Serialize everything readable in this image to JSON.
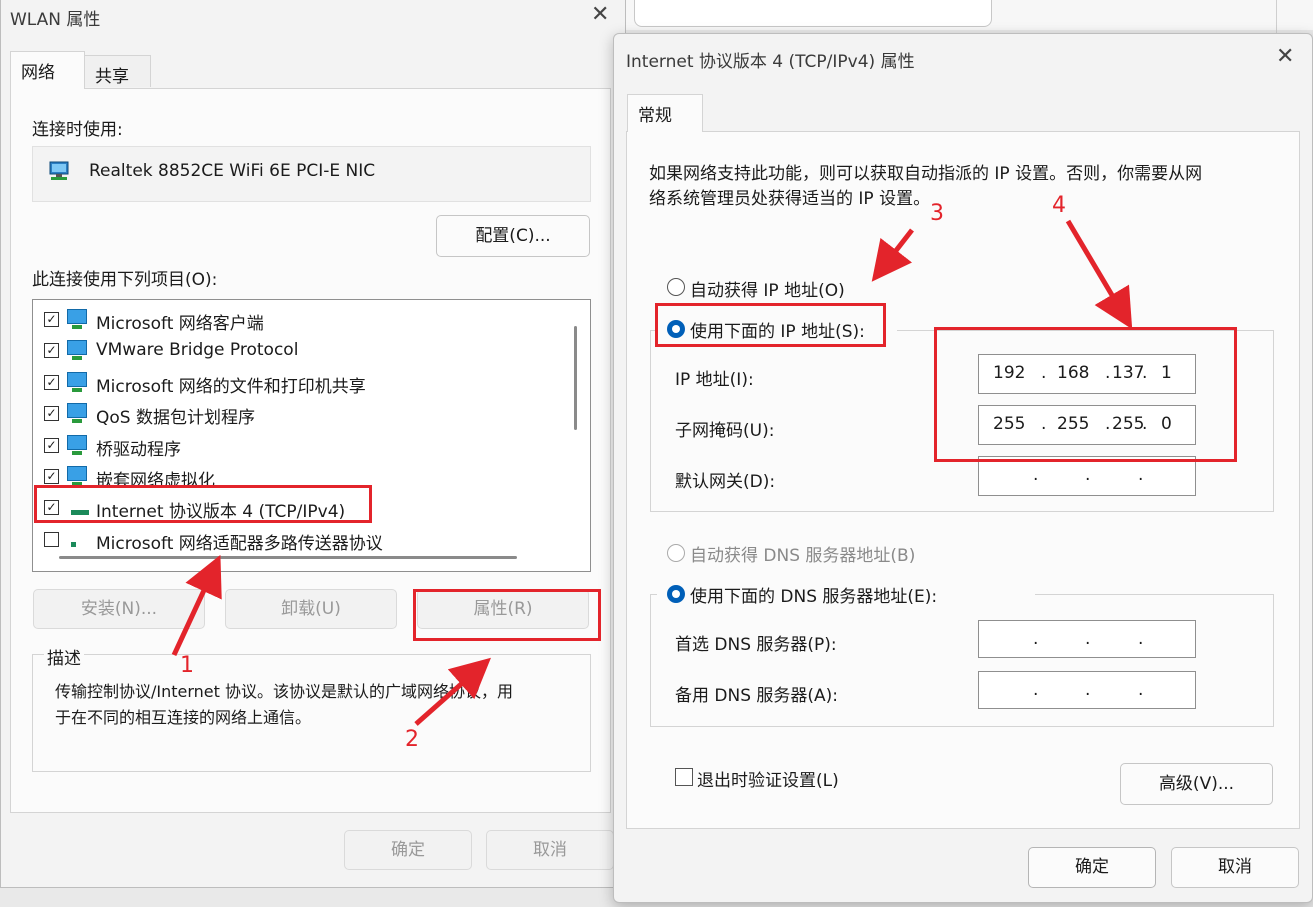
{
  "wlan": {
    "title": "WLAN 属性",
    "tabs": [
      "网络",
      "共享"
    ],
    "connect_using_label": "连接时使用:",
    "adapter_name": "Realtek 8852CE WiFi 6E PCI-E NIC",
    "configure_button": "配置(C)...",
    "items_label": "此连接使用下列项目(O):",
    "items": [
      {
        "label": "Microsoft 网络客户端",
        "checked": true
      },
      {
        "label": "VMware Bridge Protocol",
        "checked": true
      },
      {
        "label": "Microsoft 网络的文件和打印机共享",
        "checked": true
      },
      {
        "label": "QoS 数据包计划程序",
        "checked": true
      },
      {
        "label": "桥驱动程序",
        "checked": true
      },
      {
        "label": "嵌套网络虚拟化",
        "checked": true
      },
      {
        "label": "Internet 协议版本 4 (TCP/IPv4)",
        "checked": true
      },
      {
        "label": "Microsoft 网络适配器多路传送器协议",
        "checked": false
      }
    ],
    "install_button": "安装(N)...",
    "uninstall_button": "卸载(U)",
    "properties_button": "属性(R)",
    "description_title": "描述",
    "description_line1": "传输控制协议/Internet 协议。该协议是默认的广域网络协议，用",
    "description_line2": "于在不同的相互连接的网络上通信。",
    "ok_button": "确定",
    "cancel_button": "取消"
  },
  "ipv4": {
    "title": "Internet 协议版本 4 (TCP/IPv4) 属性",
    "tab": "常规",
    "intro_line1": "如果网络支持此功能，则可以获取自动指派的 IP 设置。否则，你需要从网",
    "intro_line2": "络系统管理员处获得适当的 IP 设置。",
    "auto_ip_label": "自动获得 IP 地址(O)",
    "manual_ip_label": "使用下面的 IP 地址(S):",
    "ip_label": "IP 地址(I):",
    "ip_octets": [
      "192",
      "168",
      "137",
      "1"
    ],
    "subnet_label": "子网掩码(U):",
    "subnet_octets": [
      "255",
      "255",
      "255",
      "0"
    ],
    "gateway_label": "默认网关(D):",
    "auto_dns_label": "自动获得 DNS 服务器地址(B)",
    "manual_dns_label": "使用下面的 DNS 服务器地址(E):",
    "preferred_dns_label": "首选 DNS 服务器(P):",
    "alternate_dns_label": "备用 DNS 服务器(A):",
    "validate_label": "退出时验证设置(L)",
    "advanced_button": "高级(V)...",
    "ok_button": "确定",
    "cancel_button": "取消"
  },
  "annotations": {
    "n1": "1",
    "n2": "2",
    "n3": "3",
    "n4": "4",
    "color": "#e3242b"
  },
  "colors": {
    "accent": "#005fb8",
    "window_bg": "#f3f3f3"
  }
}
